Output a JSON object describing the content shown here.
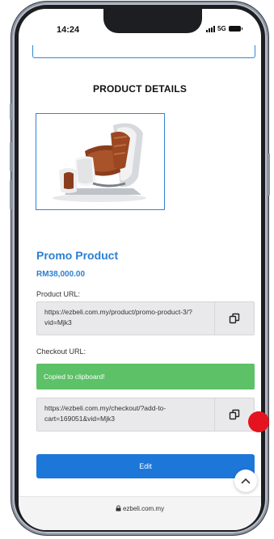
{
  "status_bar": {
    "time": "14:24",
    "network": "5G"
  },
  "page": {
    "section_title": "PRODUCT DETAILS",
    "product": {
      "name": "Promo Product",
      "price": "RM38,000.00",
      "image_alt": "Massage chair image"
    },
    "product_url": {
      "label": "Product URL:",
      "value": "https://ezbeli.com.my/product/promo-product-3/?vid=Mjk3"
    },
    "checkout_url": {
      "label": "Checkout URL:",
      "toast": "Copied to clipboard!",
      "value": "https://ezbeli.com.my/checkout/?add-to-cart=169051&vid=Mjk3"
    },
    "edit_button": "Edit"
  },
  "browser": {
    "address": "ezbeli.com.my"
  },
  "colors": {
    "accent": "#2a7fd4",
    "button": "#1d77d8",
    "success": "#5cc167",
    "indicator": "#e5131e"
  },
  "icons": {
    "copy": "copy-icon",
    "scroll_top": "chevron-up-icon",
    "lock": "lock-icon"
  }
}
